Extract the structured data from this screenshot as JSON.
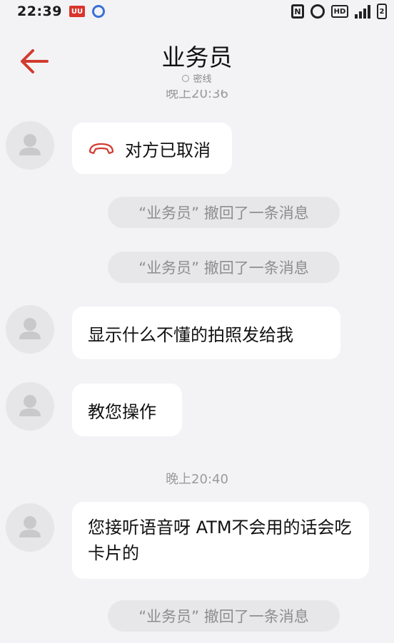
{
  "status_bar": {
    "time": "22:39",
    "app_badge": "UU",
    "hd": "HD",
    "nfc": "N",
    "battery": "2"
  },
  "header": {
    "title": "业务员",
    "subtitle": "密线"
  },
  "timestamps": {
    "top_partial": "晚上20:36",
    "second": "晚上20:40"
  },
  "messages": {
    "call_cancelled": "对方已取消",
    "recall_1": "“业务员” 撤回了一条消息",
    "recall_2": "“业务员” 撤回了一条消息",
    "msg_1": "显示什么不懂的拍照发给我",
    "msg_2": "教您操作",
    "msg_3": "您接听语音呀 ATM不会用的话会吃卡片的",
    "recall_3": "“业务员” 撤回了一条消息"
  },
  "colors": {
    "accent": "#d23a2f",
    "background": "#f3f3f6",
    "bubble": "#ffffff",
    "notice_bg": "#e7e7ea"
  }
}
